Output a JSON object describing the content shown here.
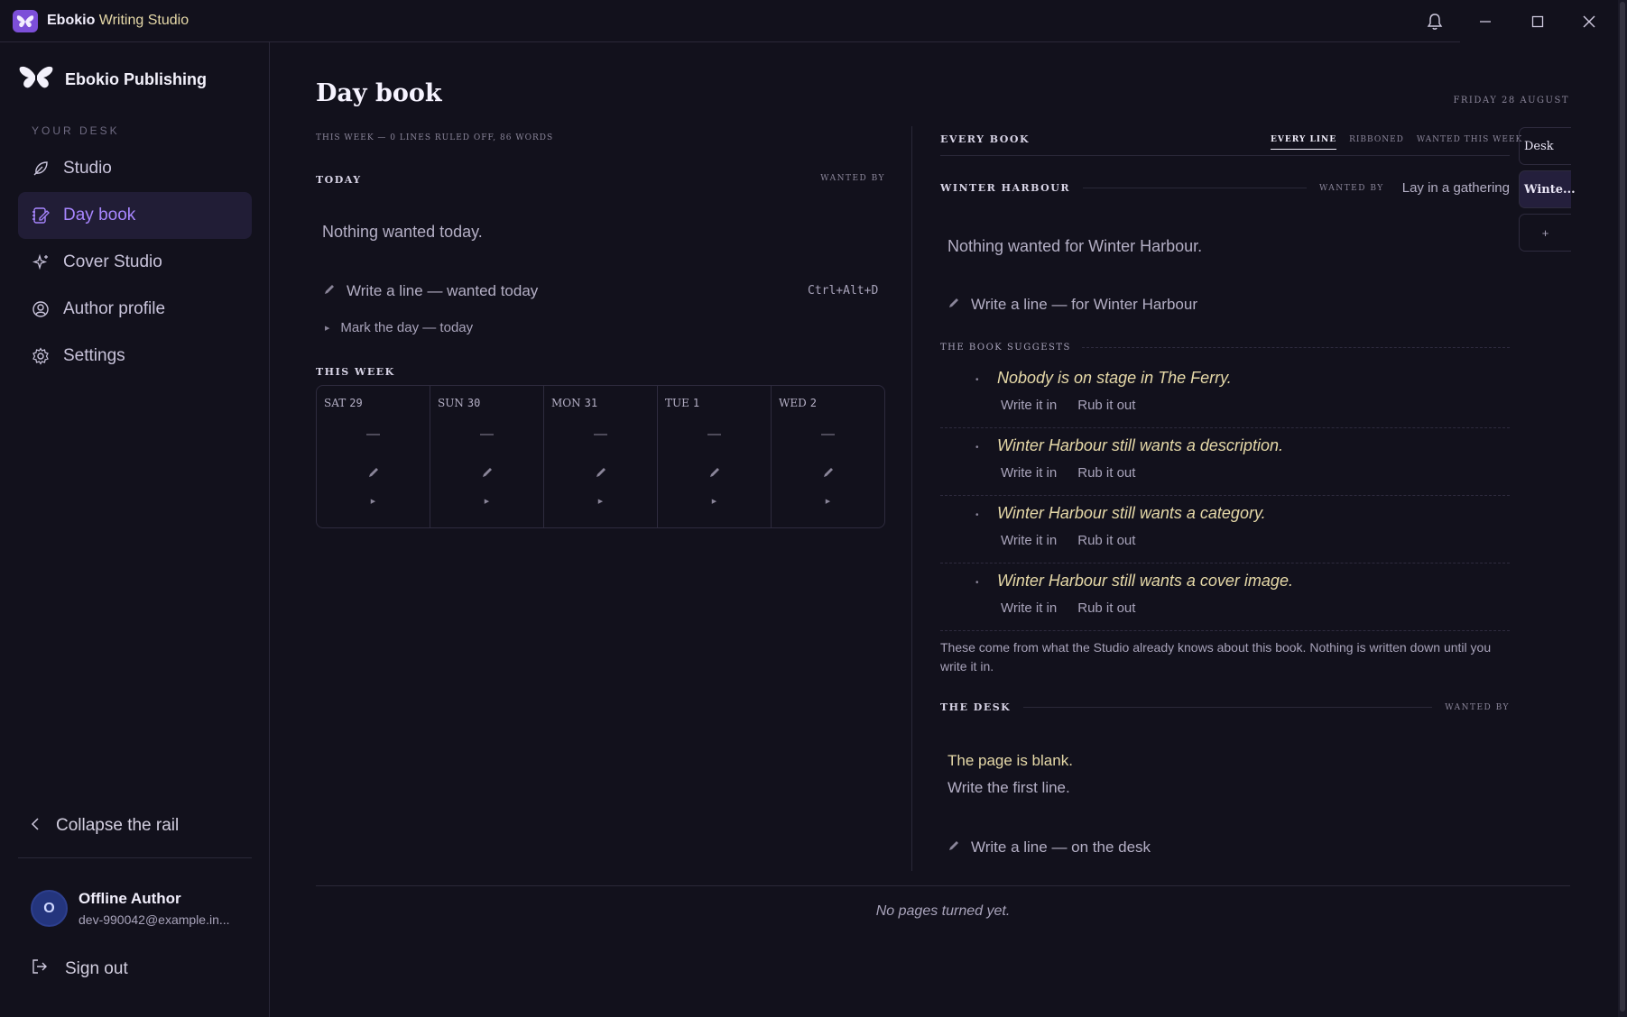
{
  "window": {
    "app_name": "Ebokio",
    "app_name_rest": " Writing Studio",
    "icons": {
      "app": "butterfly-icon",
      "bell": "bell-icon",
      "minimize": "minimize-icon",
      "maximize": "maximize-icon",
      "close": "close-icon"
    }
  },
  "sidebar": {
    "brand": "Ebokio Publishing",
    "section_label": "YOUR DESK",
    "items": [
      {
        "label": "Studio",
        "icon": "feather-icon",
        "active": false
      },
      {
        "label": "Day book",
        "icon": "notebook-pen-icon",
        "active": true
      },
      {
        "label": "Cover Studio",
        "icon": "sparkles-icon",
        "active": false
      },
      {
        "label": "Author profile",
        "icon": "user-circle-icon",
        "active": false
      },
      {
        "label": "Settings",
        "icon": "gear-icon",
        "active": false
      }
    ],
    "collapse_label": "Collapse the rail",
    "user": {
      "initial": "O",
      "name": "Offline Author",
      "email": "dev-990042@example.in..."
    },
    "signout_label": "Sign out"
  },
  "main": {
    "title": "Day book",
    "date": "FRIDAY 28 AUGUST",
    "subtitle": "THIS WEEK — 0 LINES RULED OFF, 86 WORDS",
    "today": {
      "label": "TODAY",
      "wanted_by": "WANTED BY",
      "empty": "Nothing wanted today.",
      "write_line": "Write a line — wanted today",
      "shortcut": "Ctrl+Alt+D",
      "mark_day": "Mark the day — today"
    },
    "week": {
      "label": "THIS WEEK",
      "days": [
        {
          "name": "SAT",
          "num": "29",
          "dash": "—"
        },
        {
          "name": "SUN",
          "num": "30",
          "dash": "—"
        },
        {
          "name": "MON",
          "num": "31",
          "dash": "—"
        },
        {
          "name": "TUE",
          "num": "1",
          "dash": "—"
        },
        {
          "name": "WED",
          "num": "2",
          "dash": "—"
        }
      ]
    }
  },
  "right": {
    "heading": "EVERY BOOK",
    "filters": [
      {
        "label": "EVERY LINE",
        "active": true
      },
      {
        "label": "RIBBONED",
        "active": false
      },
      {
        "label": "WANTED THIS WEEK",
        "active": false
      }
    ],
    "book_tabs": [
      {
        "label": "Desk",
        "selected": false
      },
      {
        "label": "Winte...",
        "selected": true
      },
      {
        "label": "+",
        "selected": false
      }
    ],
    "book": {
      "name": "WINTER HARBOUR",
      "wanted_by": "WANTED BY",
      "wanted_value": "Lay in a gathering",
      "empty": "Nothing wanted for Winter Harbour.",
      "write_line": "Write a line — for Winter Harbour"
    },
    "suggests": {
      "label": "THE BOOK SUGGESTS",
      "items": [
        {
          "text": "Nobody is on stage in The Ferry.",
          "write": "Write it in",
          "rub": "Rub it out"
        },
        {
          "text": "Winter Harbour still wants a description.",
          "write": "Write it in",
          "rub": "Rub it out"
        },
        {
          "text": "Winter Harbour still wants a category.",
          "write": "Write it in",
          "rub": "Rub it out"
        },
        {
          "text": "Winter Harbour still wants a cover image.",
          "write": "Write it in",
          "rub": "Rub it out"
        }
      ],
      "note": "These come from what the Studio already knows about this book. Nothing is written down until you write it in."
    },
    "desk": {
      "label": "THE DESK",
      "wanted_by": "WANTED BY",
      "blank_line1": "The page is blank.",
      "blank_line2": "Write the first line.",
      "write_line": "Write a line — on the desk"
    }
  },
  "footer": {
    "no_pages": "No pages turned yet."
  },
  "colors": {
    "accent": "#a886ff",
    "highlight_text": "#e6d9a8",
    "background": "#12111c"
  }
}
